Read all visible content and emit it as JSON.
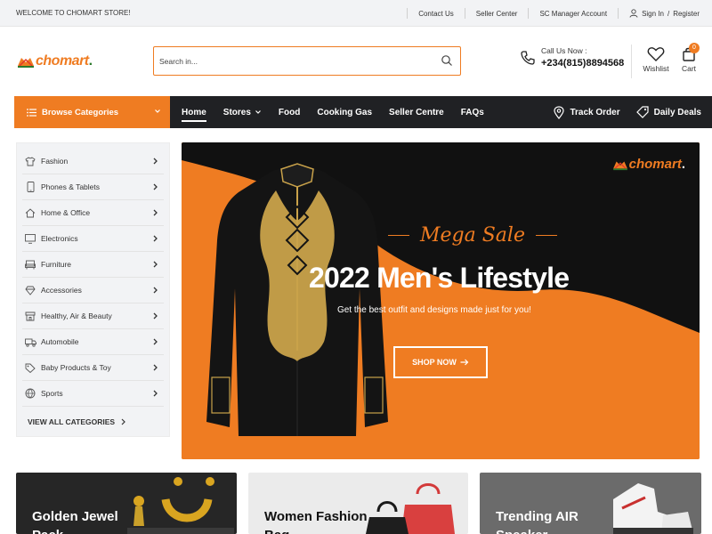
{
  "topbar": {
    "welcome": "WELCOME TO CHOMART STORE!",
    "contact": "Contact Us",
    "seller_center": "Seller Center",
    "sc_manager": "SC Manager Account",
    "sign_in": "Sign In",
    "slash": "/",
    "register": "Register"
  },
  "header": {
    "logo_text": "chomart",
    "logo_dot": ".",
    "search_placeholder": "Search in...",
    "call_label": "Call Us Now :",
    "call_number": "+234(815)8894568",
    "wishlist": "Wishlist",
    "cart": "Cart",
    "cart_count": "0"
  },
  "nav": {
    "browse": "Browse Categories",
    "links": [
      "Home",
      "Stores",
      "Food",
      "Cooking Gas",
      "Seller Centre",
      "FAQs"
    ],
    "track": "Track Order",
    "deals": "Daily Deals"
  },
  "sidebar": {
    "items": [
      {
        "label": "Fashion",
        "icon": "shirt-icon"
      },
      {
        "label": "Phones & Tablets",
        "icon": "phone-icon"
      },
      {
        "label": "Home & Office",
        "icon": "home-icon"
      },
      {
        "label": "Electronics",
        "icon": "monitor-icon"
      },
      {
        "label": "Furniture",
        "icon": "sofa-icon"
      },
      {
        "label": "Accessories",
        "icon": "diamond-icon"
      },
      {
        "label": "Healthy, Air & Beauty",
        "icon": "store-icon"
      },
      {
        "label": "Automobile",
        "icon": "truck-icon"
      },
      {
        "label": "Baby Products & Toy",
        "icon": "tag-icon"
      },
      {
        "label": "Sports",
        "icon": "ball-icon"
      }
    ],
    "view_all": "VIEW ALL CATEGORIES"
  },
  "hero": {
    "brand": "chomart",
    "brand_dot": ".",
    "mega": "Mega Sale",
    "title": "2022 Men's Lifestyle",
    "subtitle": "Get the best outfit and designs made just for you!",
    "cta": "SHOP NOW"
  },
  "cards": [
    {
      "title": "Golden Jewel Pack"
    },
    {
      "title": "Women Fashion Bag"
    },
    {
      "title": "Trending AIR Speaker"
    }
  ],
  "colors": {
    "accent": "#ef7c22",
    "dark": "#202124",
    "panel": "#f2f3f5"
  }
}
